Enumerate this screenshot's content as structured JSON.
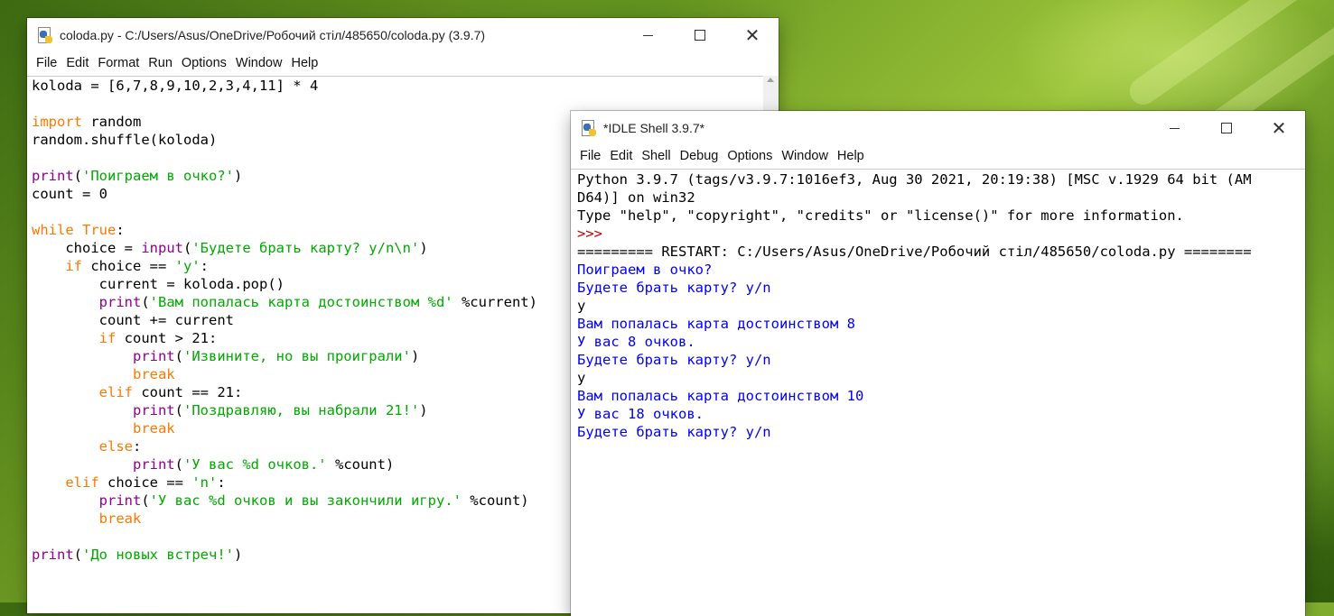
{
  "editor": {
    "title": "coloda.py - C:/Users/Asus/OneDrive/Робочий стіл/485650/coloda.py (3.9.7)",
    "menu": [
      "File",
      "Edit",
      "Format",
      "Run",
      "Options",
      "Window",
      "Help"
    ],
    "code_lines": [
      "koloda = [6,7,8,9,10,2,3,4,11] * 4",
      "",
      "import random",
      "random.shuffle(koloda)",
      "",
      "print('Поиграем в очко?')",
      "count = 0",
      "",
      "while True:",
      "    choice = input('Будете брать карту? y/n\\n')",
      "    if choice == 'y':",
      "        current = koloda.pop()",
      "        print('Вам попалась карта достоинством %d' %current)",
      "        count += current",
      "        if count > 21:",
      "            print('Извините, но вы проиграли')",
      "            break",
      "        elif count == 21:",
      "            print('Поздравляю, вы набрали 21!')",
      "            break",
      "        else:",
      "            print('У вас %d очков.' %count)",
      "    elif choice == 'n':",
      "        print('У вас %d очков и вы закончили игру.' %count)",
      "        break",
      "",
      "print('До новых встреч!')"
    ]
  },
  "shell": {
    "title": "*IDLE Shell 3.9.7*",
    "menu": [
      "File",
      "Edit",
      "Shell",
      "Debug",
      "Options",
      "Window",
      "Help"
    ],
    "lines": [
      {
        "type": "normal",
        "text": "Python 3.9.7 (tags/v3.9.7:1016ef3, Aug 30 2021, 20:19:38) [MSC v.1929 64 bit (AM"
      },
      {
        "type": "normal",
        "text": "D64)] on win32"
      },
      {
        "type": "normal",
        "text": "Type \"help\", \"copyright\", \"credits\" or \"license()\" for more information."
      },
      {
        "type": "prompt",
        "text": ">>>"
      },
      {
        "type": "normal",
        "text": "========= RESTART: C:/Users/Asus/OneDrive/Робочий стіл/485650/coloda.py ========"
      },
      {
        "type": "output",
        "text": "Поиграем в очко?"
      },
      {
        "type": "output",
        "text": "Будете брать карту? y/n"
      },
      {
        "type": "normal",
        "text": "y"
      },
      {
        "type": "output",
        "text": "Вам попалась карта достоинством 8"
      },
      {
        "type": "output",
        "text": "У вас 8 очков."
      },
      {
        "type": "output",
        "text": "Будете брать карту? y/n"
      },
      {
        "type": "normal",
        "text": "y"
      },
      {
        "type": "output",
        "text": "Вам попалась карта достоинством 10"
      },
      {
        "type": "output",
        "text": "У вас 18 очков."
      },
      {
        "type": "output",
        "text": "Будете брать карту? y/n"
      }
    ]
  }
}
